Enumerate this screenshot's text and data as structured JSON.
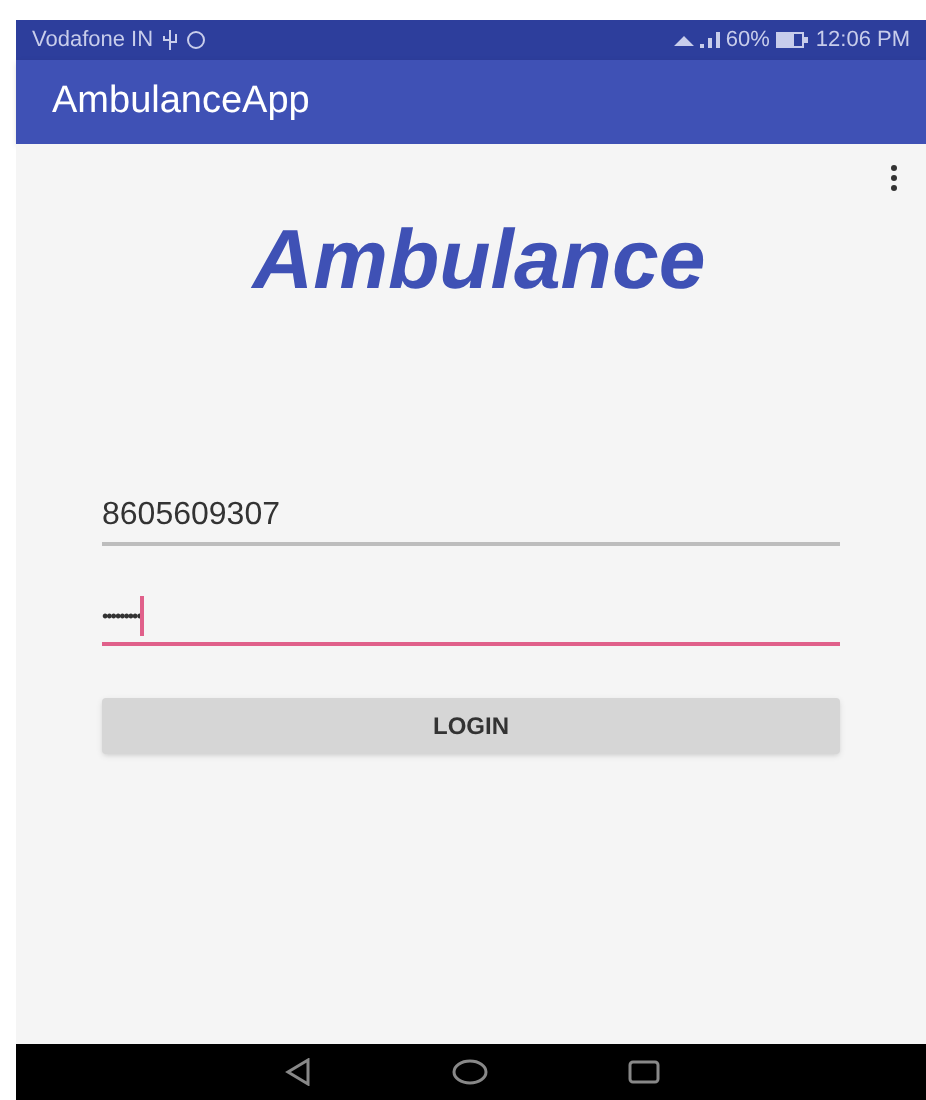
{
  "status_bar": {
    "carrier": "Vodafone IN",
    "battery": "60%",
    "time": "12:06 PM"
  },
  "app_bar": {
    "title": "AmbulanceApp"
  },
  "logo": "Ambulance",
  "fields": [
    {
      "kind": "phone",
      "value": "8605609307",
      "focused": false
    },
    {
      "kind": "password",
      "value": "•••••••••",
      "focused": true
    }
  ],
  "login_button": "LOGIN"
}
